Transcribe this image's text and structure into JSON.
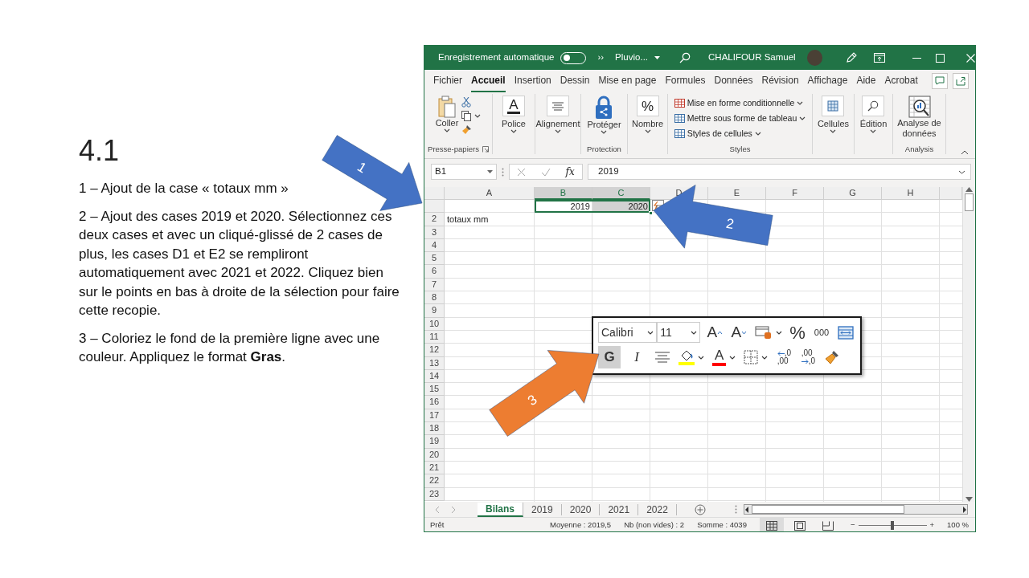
{
  "slide": {
    "title": "4.1",
    "paragraphs": [
      "1 – Ajout de la case « totaux mm »",
      "2 – Ajout des cases 2019 et 2020. Sélectionnez ces deux cases et avec un cliqué-glissé de 2 cases de plus, les cases D1 et E2 se rempliront automatiquement avec 2021 et 2022. Cliquez bien sur le points en bas à droite de la sélection pour faire cette recopie.",
      "3 – Coloriez le fond de la première ligne avec une couleur. Appliquez le format **Gras**."
    ]
  },
  "annotations": [
    {
      "label": "1",
      "color": "#4472c4"
    },
    {
      "label": "2",
      "color": "#4472c4"
    },
    {
      "label": "3",
      "color": "#ed7d31"
    }
  ],
  "title_bar": {
    "autosave_label": "Enregistrement automatique",
    "autosave_on": false,
    "overflow": "››",
    "file_name": "Pluvio...",
    "user_name": "CHALIFOUR Samuel"
  },
  "ribbon_tabs": [
    {
      "label": "Fichier",
      "selected": false
    },
    {
      "label": "Accueil",
      "selected": true
    },
    {
      "label": "Insertion",
      "selected": false
    },
    {
      "label": "Dessin",
      "selected": false
    },
    {
      "label": "Mise en page",
      "selected": false
    },
    {
      "label": "Formules",
      "selected": false
    },
    {
      "label": "Données",
      "selected": false
    },
    {
      "label": "Révision",
      "selected": false
    },
    {
      "label": "Affichage",
      "selected": false
    },
    {
      "label": "Aide",
      "selected": false
    },
    {
      "label": "Acrobat",
      "selected": false
    }
  ],
  "ribbon_groups": [
    {
      "kind": "clipboard",
      "button": "Coller",
      "label": "Presse-papiers"
    },
    {
      "kind": "font",
      "button": "Police",
      "glyph": "A"
    },
    {
      "kind": "alignment",
      "button": "Alignement"
    },
    {
      "kind": "protect",
      "button": "Protéger",
      "label": "Protection"
    },
    {
      "kind": "number",
      "button": "Nombre",
      "glyph": "%"
    },
    {
      "kind": "styles",
      "items": [
        "Mise en forme conditionnelle",
        "Mettre sous forme de tableau",
        "Styles de cellules"
      ],
      "label": "Styles"
    },
    {
      "kind": "cells",
      "button": "Cellules"
    },
    {
      "kind": "editing",
      "button": "Édition"
    },
    {
      "kind": "analysis",
      "button": "Analyse de données",
      "label": "Analysis"
    }
  ],
  "formula_bar": {
    "name_box": "B1",
    "fx": "fx",
    "formula": "2019"
  },
  "columns": [
    {
      "label": "A",
      "selected": false
    },
    {
      "label": "B",
      "selected": true
    },
    {
      "label": "C",
      "selected": true
    },
    {
      "label": "D",
      "selected": false
    },
    {
      "label": "E",
      "selected": false
    },
    {
      "label": "F",
      "selected": false
    },
    {
      "label": "G",
      "selected": false
    },
    {
      "label": "H",
      "selected": false
    }
  ],
  "rows": [
    {
      "cells": [
        {},
        {
          "value": "2019",
          "selected": true,
          "active": true
        },
        {
          "value": "2020",
          "selected": true,
          "active": false
        }
      ]
    },
    {
      "label": "2",
      "cells": [
        {
          "value": "totaux mm"
        }
      ]
    },
    {
      "label": "3"
    },
    {
      "label": "4"
    },
    {
      "label": "5"
    },
    {
      "label": "6"
    },
    {
      "label": "7"
    },
    {
      "label": "8"
    },
    {
      "label": "9"
    },
    {
      "label": "10"
    },
    {
      "label": "11"
    },
    {
      "label": "12"
    },
    {
      "label": "13"
    },
    {
      "label": "14"
    },
    {
      "label": "15"
    },
    {
      "label": "16"
    },
    {
      "label": "17"
    },
    {
      "label": "18"
    },
    {
      "label": "19"
    },
    {
      "label": "20"
    },
    {
      "label": "21"
    },
    {
      "label": "22"
    },
    {
      "label": "23"
    }
  ],
  "mini_toolbar": {
    "font": "Calibri",
    "size": "11",
    "row1": [
      {
        "kind": "grow-font",
        "glyph": "A"
      },
      {
        "kind": "shrink-font",
        "glyph": "A"
      },
      {
        "kind": "format-table"
      },
      {
        "kind": "percent",
        "glyph": "%"
      },
      {
        "kind": "thousands",
        "glyph": "000"
      },
      {
        "kind": "wrap"
      }
    ],
    "row2": [
      {
        "kind": "bold",
        "glyph": "G",
        "selected": true
      },
      {
        "kind": "italic",
        "glyph": "I",
        "selected": false
      },
      {
        "kind": "center"
      },
      {
        "kind": "fill-color",
        "color": "#ffff00"
      },
      {
        "kind": "font-color",
        "glyph": "A",
        "color": "#ff0000"
      },
      {
        "kind": "borders"
      },
      {
        "kind": "decimal-increase",
        "glyphs": [
          ",0",
          ",00"
        ]
      },
      {
        "kind": "decimal-decrease",
        "glyphs": [
          ",00",
          ",0"
        ]
      },
      {
        "kind": "format-painter"
      }
    ]
  },
  "sheet_tabs": [
    {
      "label": "Bilans",
      "selected": true
    },
    {
      "label": "2019",
      "selected": false
    },
    {
      "label": "2020",
      "selected": false
    },
    {
      "label": "2021",
      "selected": false
    },
    {
      "label": "2022",
      "selected": false
    }
  ],
  "status_bar": {
    "ready": "Prêt",
    "stats": [
      "Moyenne : 2019,5",
      "Nb (non vides) : 2",
      "Somme : 4039"
    ],
    "views": [
      {
        "kind": "normal",
        "selected": true
      },
      {
        "kind": "page-layout",
        "selected": false
      },
      {
        "kind": "page-break",
        "selected": false
      }
    ],
    "zoom": {
      "minus": "−",
      "plus": "+",
      "level": 0.5,
      "reading": "100 %"
    }
  }
}
